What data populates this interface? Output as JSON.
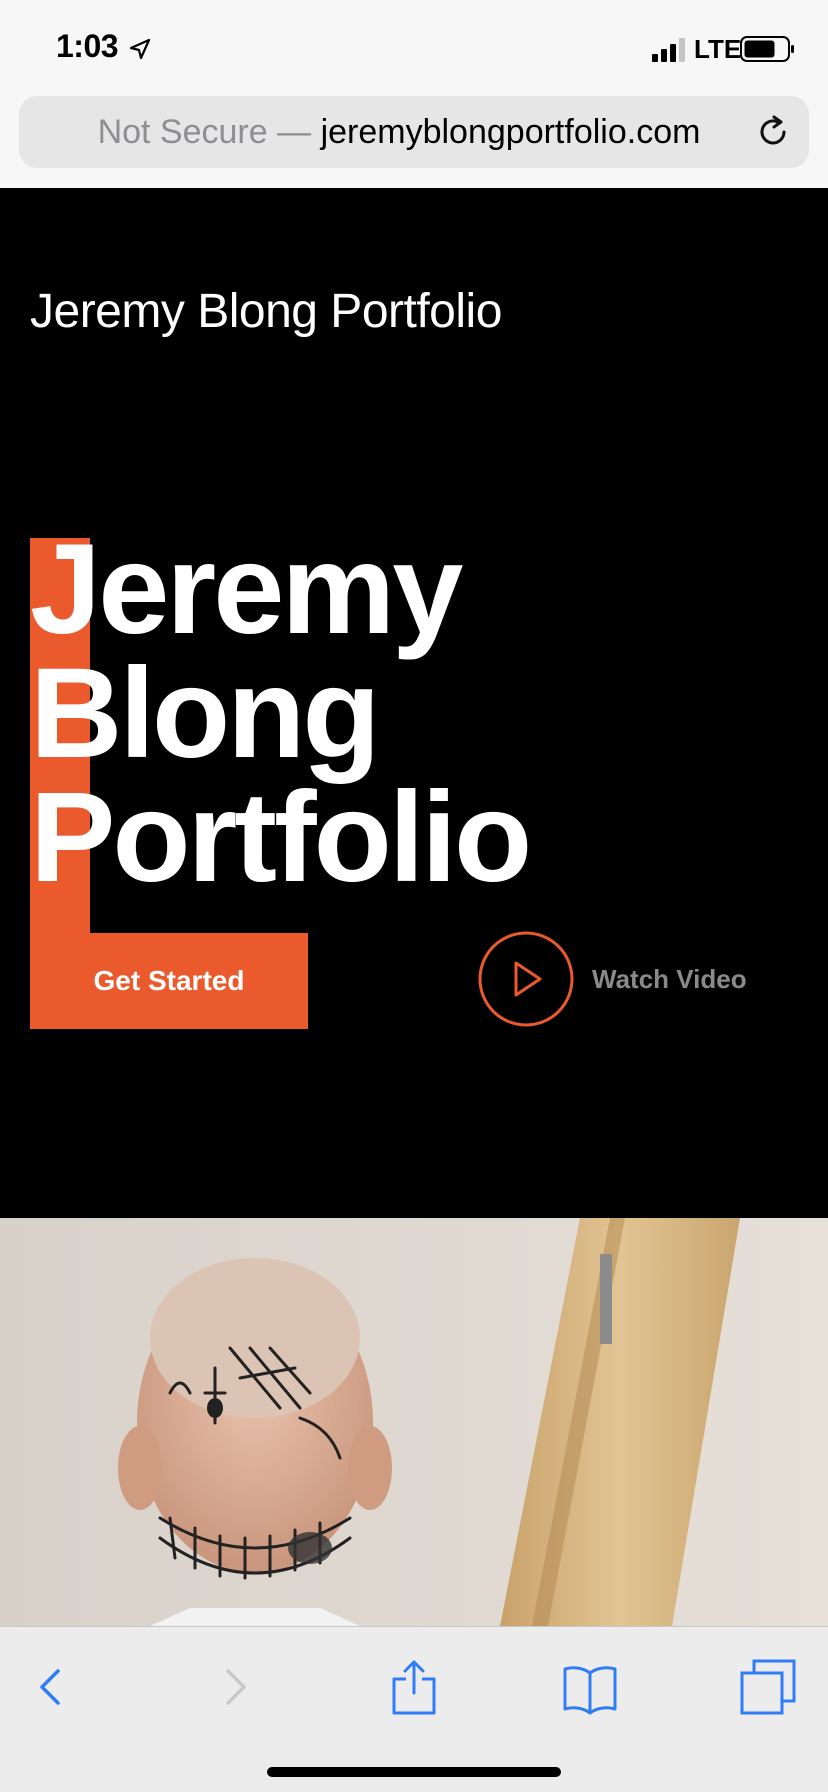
{
  "status_bar": {
    "time": "1:03",
    "network": "LTE",
    "icons": [
      "location-arrow-icon",
      "signal-bars-icon",
      "battery-icon"
    ]
  },
  "address_bar": {
    "security": "Not Secure",
    "separator": " — ",
    "domain": "jeremyblongportfolio.com",
    "icon": "reload-icon"
  },
  "hero": {
    "site_title": "Jeremy Blong Portfolio",
    "headline_lines": [
      "Jeremy",
      "Blong",
      "Portfolio"
    ],
    "cta_label": "Get Started",
    "watch_label": "Watch Video",
    "play_icon": "play-icon"
  },
  "photo": {
    "icon": "hero-photo"
  },
  "toolbar": {
    "icons": [
      "back-icon",
      "forward-icon",
      "share-icon",
      "bookmarks-icon",
      "tabs-icon"
    ]
  },
  "colors": {
    "accent": "#ea5a2c",
    "hero_bg": "#000000",
    "link_blue": "#2f7cf6",
    "muted_gray": "#8a8a8a"
  }
}
